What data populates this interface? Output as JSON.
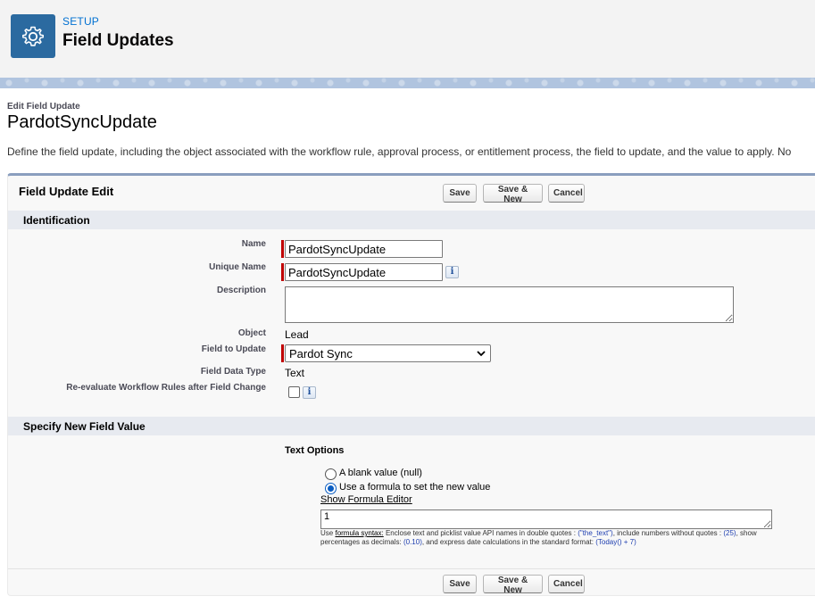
{
  "header": {
    "setup_label": "SETUP",
    "title": "Field Updates",
    "icon": "gear-icon"
  },
  "page": {
    "edit_label": "Edit Field Update",
    "record_title": "PardotSyncUpdate",
    "description": "Define the field update, including the object associated with the workflow rule, approval process, or entitlement process, the field to update, and the value to apply. No"
  },
  "block": {
    "title": "Field Update Edit",
    "buttons": {
      "save": "Save",
      "save_new": "Save & New",
      "cancel": "Cancel"
    }
  },
  "identification": {
    "section_title": "Identification",
    "name_label": "Name",
    "name_value": "PardotSyncUpdate",
    "unique_name_label": "Unique Name",
    "unique_name_value": "PardotSyncUpdate",
    "description_label": "Description",
    "description_value": "",
    "object_label": "Object",
    "object_value": "Lead",
    "field_to_update_label": "Field to Update",
    "field_to_update_value": "Pardot Sync",
    "field_data_type_label": "Field Data Type",
    "field_data_type_value": "Text",
    "reevaluate_label": "Re-evaluate Workflow Rules after Field Change",
    "reevaluate_checked": false,
    "info_glyph": "i"
  },
  "new_value": {
    "section_title": "Specify New Field Value",
    "text_options_label": "Text Options",
    "option_blank": "A blank value (null)",
    "option_formula": "Use a formula to set the new value",
    "selected_option": "formula",
    "show_formula_editor": "Show Formula Editor",
    "formula_value": "1",
    "help": {
      "use": "Use",
      "formula_syntax": "formula syntax:",
      "part1": "Enclose text and picklist value API names in double quotes :",
      "ex_text": "(\"the_text\")",
      "part2": ", include numbers without quotes :",
      "ex_number": "(25)",
      "part3": ", show percentages as decimals:",
      "ex_percent": "(0.10)",
      "part4": ", and express date calculations in the standard format:",
      "ex_date": "(Today() + 7)"
    }
  },
  "colors": {
    "setup_icon_bg": "#2b6aa0",
    "link_blue": "#0070d2",
    "required_red": "#c00000",
    "section_bg": "#e7eaf0",
    "block_border": "#8a9ebe"
  }
}
